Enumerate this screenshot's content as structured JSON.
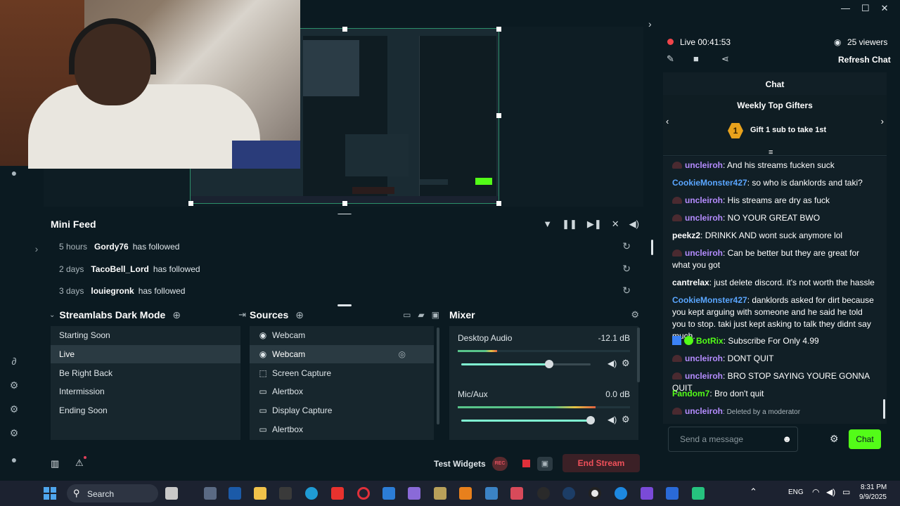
{
  "window": {
    "minimize": "—",
    "maximize": "☐",
    "close": "✕"
  },
  "status": {
    "live_label": "Live",
    "live_time": "00:41:53",
    "viewers": "25 viewers"
  },
  "chat_header": {
    "refresh": "Refresh Chat",
    "title": "Chat",
    "top_gifters_title": "Weekly Top Gifters",
    "gift_rank": "1",
    "gift_text": "Gift 1 sub to take 1st"
  },
  "chat_messages": [
    {
      "user": "uncleiroh",
      "color": "#b58cff",
      "badge": true,
      "text": ": And his streams fucken suck"
    },
    {
      "user": "CookieMonster427",
      "color": "#5aa6ff",
      "badge": false,
      "text": ": so who is danklords and taki?"
    },
    {
      "user": "uncleiroh",
      "color": "#b58cff",
      "badge": true,
      "text": ": His streams are dry as fuck"
    },
    {
      "user": "uncleiroh",
      "color": "#b58cff",
      "badge": true,
      "text": ": NO YOUR GREAT BWO"
    },
    {
      "user": "peekz2",
      "color": "#ffffff",
      "badge": false,
      "text": ": DRINKK AND wont suck anymore lol"
    },
    {
      "user": "uncleiroh",
      "color": "#b58cff",
      "badge": true,
      "text": ": Can be better but they are great for what you got"
    },
    {
      "user": "cantrelax",
      "color": "#ffffff",
      "badge": false,
      "text": ": just delete discord. it's not worth the hassle"
    },
    {
      "user": "CookieMonster427",
      "color": "#5aa6ff",
      "badge": false,
      "text": ": danklords asked for dirt because you kept arguing with someone and he said he told you to stop. taki just kept asking to talk they didnt say much."
    },
    {
      "user": "BotRix",
      "color": "#53fc18",
      "badge": false,
      "bot": true,
      "text": ": Subscribe For Only 4.99"
    },
    {
      "user": "uncleiroh",
      "color": "#b58cff",
      "badge": true,
      "text": ": DONT QUIT"
    },
    {
      "user": "uncleiroh",
      "color": "#b58cff",
      "badge": true,
      "text": ": BRO STOP SAYING YOURE GONNA QUIT"
    },
    {
      "user": "Fandom7",
      "color": "#53fc18",
      "badge": false,
      "text": ": Bro don't quit"
    },
    {
      "user": "uncleiroh",
      "color": "#b58cff",
      "badge": true,
      "text": ": Deleted by a moderator",
      "deleted": true
    }
  ],
  "chat_input": {
    "placeholder": "Send a message",
    "send": "Chat"
  },
  "minifeed": {
    "title": "Mini Feed",
    "items": [
      {
        "time": "5 hours",
        "name": "Gordy76",
        "action": "has followed"
      },
      {
        "time": "2 days",
        "name": "TacoBell_Lord",
        "action": "has followed"
      },
      {
        "time": "3 days",
        "name": "louiegronk",
        "action": "has followed"
      }
    ]
  },
  "scenes": {
    "title": "Streamlabs Dark Mode",
    "items": [
      "Starting Soon",
      "Live",
      "Be Right Back",
      "Intermission",
      "Ending Soon"
    ],
    "active_index": 1
  },
  "sources": {
    "title": "Sources",
    "items": [
      {
        "label": "Webcam",
        "icon": "webcam-icon",
        "glyph": "◉"
      },
      {
        "label": "Webcam",
        "icon": "webcam-icon",
        "glyph": "◉"
      },
      {
        "label": "Screen Capture",
        "icon": "screen-capture-icon",
        "glyph": "⬚"
      },
      {
        "label": "Alertbox",
        "icon": "alertbox-icon",
        "glyph": "▭"
      },
      {
        "label": "Display Capture",
        "icon": "display-icon",
        "glyph": "▭"
      },
      {
        "label": "Alertbox",
        "icon": "alertbox-icon",
        "glyph": "▭"
      }
    ]
  },
  "mixer": {
    "title": "Mixer",
    "channels": [
      {
        "name": "Desktop Audio",
        "db": "-12.1 dB",
        "meter": 0.23,
        "volume": 0.68
      },
      {
        "name": "Mic/Aux",
        "db": "0.0 dB",
        "meter": 0.8,
        "volume": 1.0
      }
    ]
  },
  "bottom_bar": {
    "test_widgets": "Test Widgets",
    "rec": "REC",
    "end_stream": "End Stream"
  },
  "taskbar": {
    "search": "Search",
    "lang": "ENG",
    "time": "8:31 PM",
    "date": "9/9/2025"
  }
}
